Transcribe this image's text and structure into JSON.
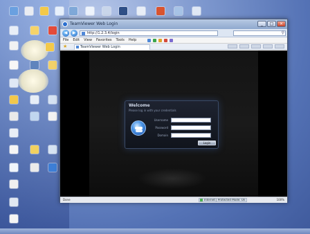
{
  "browser": {
    "title": "TeamViewer Web Login",
    "url": "http://1.2.3.4/login",
    "tab_title": "TeamViewer Web Login",
    "window_buttons": [
      "_",
      "□",
      "×"
    ],
    "menu": [
      "File",
      "Edit",
      "View",
      "Favorites",
      "Tools",
      "Help"
    ],
    "back_glyph": "◀",
    "forward_glyph": "▶",
    "favorites_glyph": "★",
    "search_glyph": "⚲",
    "status": "Done",
    "zone": "Internet | Protected Mode: On",
    "zoom": "100%"
  },
  "login": {
    "title": "Welcome",
    "subtitle": "Please log in with your credentials",
    "fields": [
      {
        "label": "Username",
        "value": ""
      },
      {
        "label": "Password",
        "value": ""
      },
      {
        "label": "Domain",
        "value": ""
      }
    ],
    "button_label": "Login"
  },
  "footer": {
    "text": ""
  },
  "colors": {
    "desktop_blue": "#5472b5",
    "page_background": "#000000",
    "panel_border": "#3a4a66",
    "logo_blue": "#1c4fa8"
  },
  "icons": [
    "browser-logo-icon",
    "back-icon",
    "forward-icon",
    "page-icon",
    "search-icon",
    "favorites-star-icon",
    "login-logo-icon",
    "zone-icon"
  ]
}
